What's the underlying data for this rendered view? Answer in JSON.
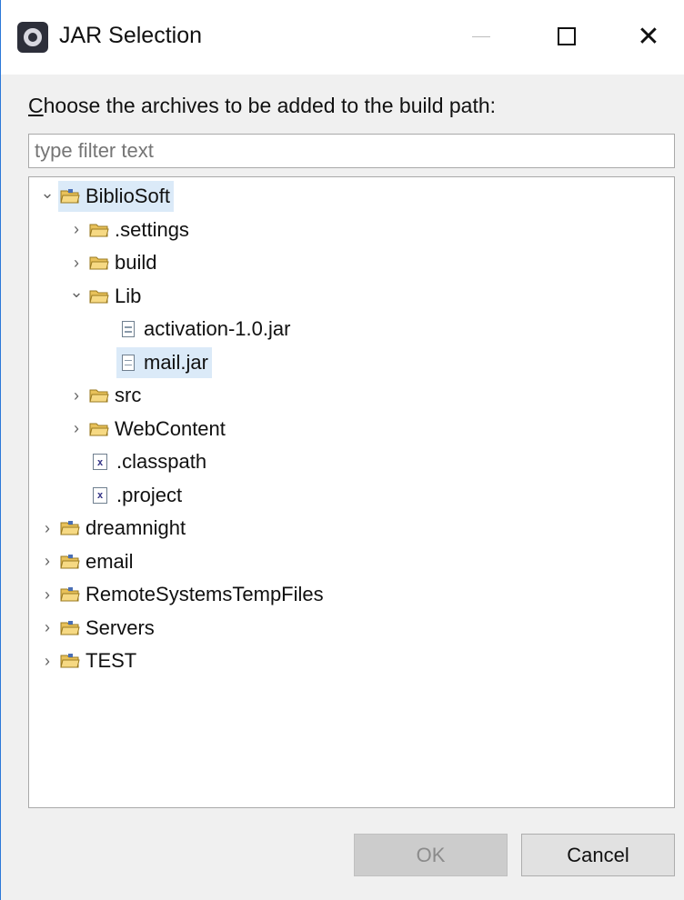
{
  "window": {
    "title": "JAR Selection",
    "icon": "eclipse-icon"
  },
  "dialog": {
    "prompt_mnemonic": "C",
    "prompt_rest": "hoose the archives to be added to the build path:",
    "filter_placeholder": "type filter text"
  },
  "tree": {
    "nodes": [
      {
        "label": "BiblioSoft",
        "icon": "project-folder-icon",
        "expanded": true,
        "selected": true
      },
      {
        "label": ".settings",
        "icon": "folder-icon",
        "expanded": false
      },
      {
        "label": "build",
        "icon": "folder-icon",
        "expanded": false
      },
      {
        "label": "Lib",
        "icon": "folder-icon",
        "expanded": true
      },
      {
        "label": "activation-1.0.jar",
        "icon": "file-icon"
      },
      {
        "label": "mail.jar",
        "icon": "file-icon",
        "selected": true
      },
      {
        "label": "src",
        "icon": "folder-icon",
        "expanded": false
      },
      {
        "label": "WebContent",
        "icon": "folder-icon",
        "expanded": false
      },
      {
        "label": ".classpath",
        "icon": "xml-file-icon"
      },
      {
        "label": ".project",
        "icon": "xml-file-icon"
      },
      {
        "label": "dreamnight",
        "icon": "project-folder-icon",
        "expanded": false
      },
      {
        "label": "email",
        "icon": "project-folder-icon",
        "expanded": false
      },
      {
        "label": "RemoteSystemsTempFiles",
        "icon": "project-folder-icon",
        "expanded": false
      },
      {
        "label": "Servers",
        "icon": "project-folder-icon",
        "expanded": false
      },
      {
        "label": "TEST",
        "icon": "project-folder-icon",
        "expanded": false
      }
    ]
  },
  "buttons": {
    "ok": "OK",
    "cancel": "Cancel",
    "ok_enabled": false
  },
  "colors": {
    "selection": "#dbeaf8",
    "window_border": "#2b78d8",
    "folder": "#e8c15a"
  }
}
